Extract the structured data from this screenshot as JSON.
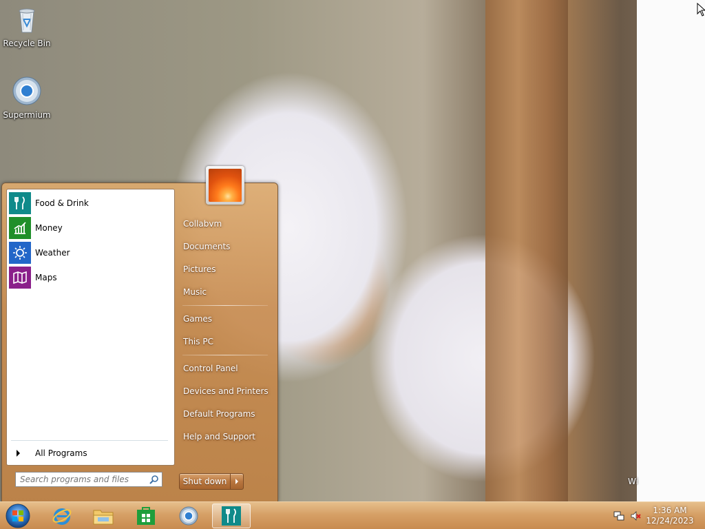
{
  "desktop": {
    "icons": [
      {
        "label": "Recycle Bin",
        "icon": "recycle-bin-icon"
      },
      {
        "label": "Supermium",
        "icon": "supermium-browser-icon"
      }
    ],
    "watermark": "Wi"
  },
  "start_menu": {
    "programs": [
      {
        "label": "Food & Drink",
        "icon": "food-drink-icon",
        "color": "#0f8a8a"
      },
      {
        "label": "Money",
        "icon": "money-icon",
        "color": "#1f8f2a"
      },
      {
        "label": "Weather",
        "icon": "weather-icon",
        "color": "#2266c8"
      },
      {
        "label": "Maps",
        "icon": "maps-icon",
        "color": "#8a1f8a"
      }
    ],
    "all_programs": "All Programs",
    "search_placeholder": "Search programs and files",
    "right_items": [
      {
        "label": "Collabvm"
      },
      {
        "label": "Documents"
      },
      {
        "label": "Pictures"
      },
      {
        "label": "Music"
      },
      {
        "label": "Games"
      },
      {
        "label": "This PC"
      },
      {
        "label": "Control Panel"
      },
      {
        "label": "Devices and Printers"
      },
      {
        "label": "Default Programs"
      },
      {
        "label": "Help and Support"
      }
    ],
    "shutdown_label": "Shut down"
  },
  "taskbar": {
    "pinned": [
      {
        "icon": "internet-explorer-icon"
      },
      {
        "icon": "file-explorer-icon"
      },
      {
        "icon": "store-icon"
      },
      {
        "icon": "supermium-browser-icon"
      },
      {
        "icon": "food-drink-icon"
      }
    ],
    "clock": {
      "time": "1:36 AM",
      "date": "12/24/2023"
    },
    "tray": [
      {
        "icon": "network-icon"
      },
      {
        "icon": "volume-muted-icon"
      }
    ]
  }
}
